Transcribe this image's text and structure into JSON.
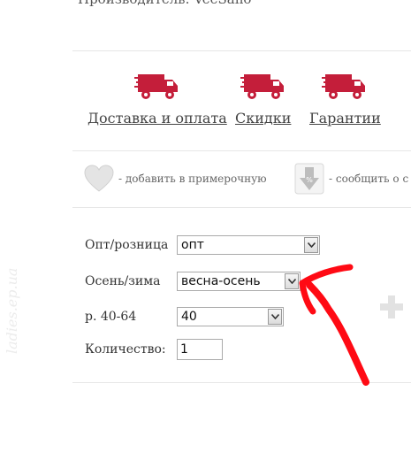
{
  "header": {
    "manufacturer_text": "Производитель: VeeSano"
  },
  "delivery": {
    "items": [
      {
        "label": "Доставка и оплата"
      },
      {
        "label": "Скидки"
      },
      {
        "label": "Гарантии"
      }
    ]
  },
  "actions": {
    "wishlist_text": "- добавить в примерочную",
    "notify_text": "- сообщить о с"
  },
  "form": {
    "wholesale": {
      "label": "Опт/розница",
      "value": "опт"
    },
    "season": {
      "label": "Осень/зима",
      "value": "весна-осень"
    },
    "size": {
      "label": "р. 40-64",
      "value": "40"
    },
    "quantity": {
      "label": "Количество:",
      "value": "1"
    }
  },
  "watermark": "ladies.ep.ua",
  "colors": {
    "truck": "#c41e3a",
    "annotation_arrow": "#ff0a14",
    "link": "#444444"
  }
}
